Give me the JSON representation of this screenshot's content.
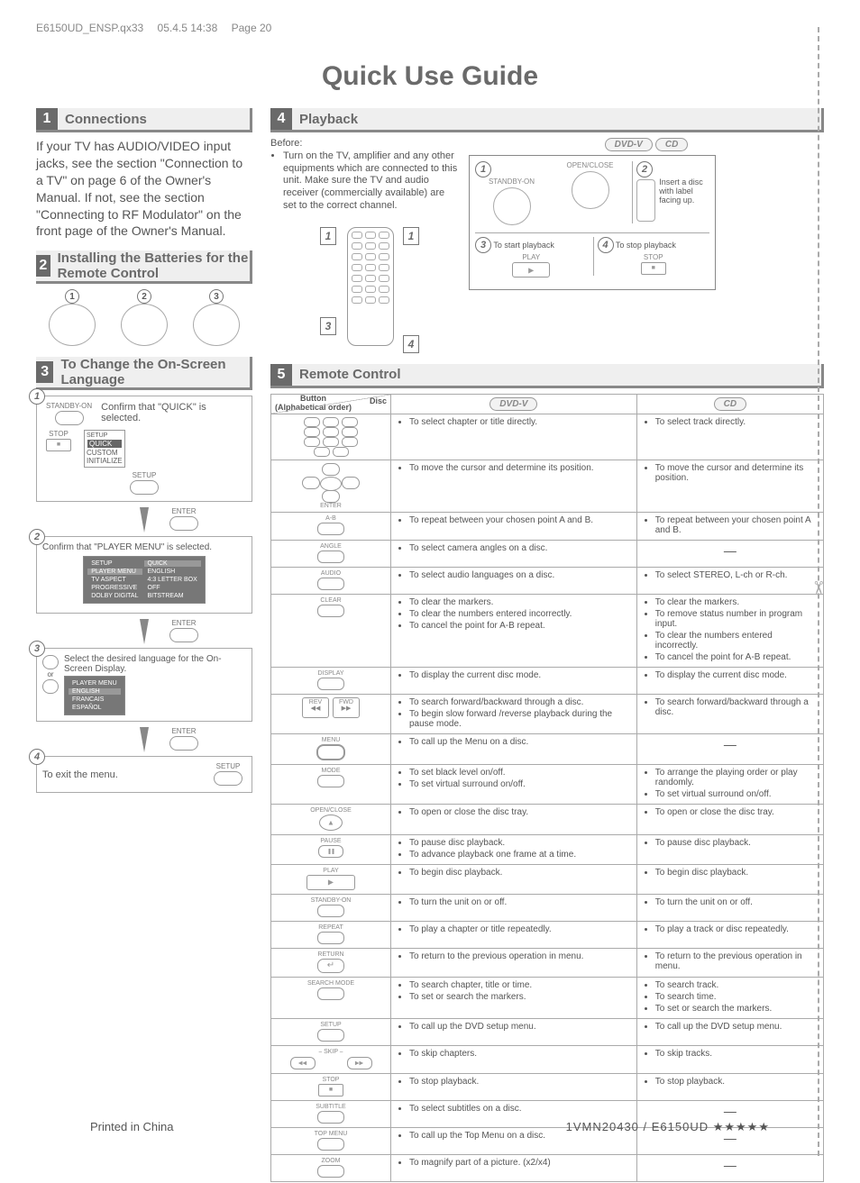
{
  "meta": {
    "file": "E6150UD_ENSP.qx33",
    "date": "05.4.5 14:38",
    "page": "Page 20"
  },
  "title": "Quick Use Guide",
  "sections": {
    "s1": {
      "num": "1",
      "title": "Connections"
    },
    "s2": {
      "num": "2",
      "title": "Installing the Batteries for the Remote Control"
    },
    "s3": {
      "num": "3",
      "title": "To Change the On-Screen Language"
    },
    "s4": {
      "num": "4",
      "title": "Playback"
    },
    "s5": {
      "num": "5",
      "title": "Remote Control"
    }
  },
  "connections_para": "If your TV has AUDIO/VIDEO input jacks, see the section \"Connection to a TV\" on page 6 of the Owner's Manual. If not, see the section \"Connecting to RF Modulator\" on the front page of the Owner's Manual.",
  "battery_steps": [
    "1",
    "2",
    "3"
  ],
  "lang": {
    "step1": {
      "num": "1",
      "standby": "STANDBY-ON",
      "confirm": "Confirm that \"QUICK\" is selected.",
      "stop": "STOP",
      "setup": "SETUP",
      "q": "QUICK",
      "c": "CUSTOM",
      "i": "INITIALIZE",
      "setup2": "SETUP"
    },
    "step2": {
      "num": "2",
      "enter": "ENTER",
      "confirm": "Confirm that \"PLAYER MENU\" is selected.",
      "menu": {
        "h1": "SETUP",
        "h2": "QUICK",
        "r1a": "PLAYER MENU",
        "r1b": "ENGLISH",
        "r2a": "TV ASPECT",
        "r2b": "4:3 LETTER BOX",
        "r3a": "PROGRESSIVE",
        "r3b": "OFF",
        "r4a": "DOLBY DIGITAL",
        "r4b": "BITSTREAM"
      }
    },
    "step3": {
      "num": "3",
      "enter": "ENTER",
      "sel": "Select the desired language for the On-Screen Display.",
      "or": "or",
      "menu": {
        "h": "PLAYER MENU",
        "o1": "ENGLISH",
        "o2": "FRANCAIS",
        "o3": "ESPAÑOL"
      }
    },
    "step4": {
      "num": "4",
      "enter": "ENTER",
      "exit": "To exit the menu.",
      "setup": "SETUP"
    }
  },
  "playback": {
    "before": "Before:",
    "bullet": "Turn on the TV, amplifier and any other equipments which are connected to this unit. Make sure the TV and audio receiver (commercially available) are set to the correct channel.",
    "callouts": {
      "c1": "1",
      "c2": "1",
      "c3": "3",
      "c4": "4"
    },
    "badges": {
      "dvd": "DVD-V",
      "cd": "CD"
    },
    "standby": "STANDBY-ON",
    "openclose": "OPEN/CLOSE",
    "insert": "Insert a disc with label facing up.",
    "p1": "1",
    "p2": "2",
    "p3": "3",
    "p4": "4",
    "start": "To start playback",
    "stop": "To stop playback",
    "play": "PLAY",
    "stopl": "STOP"
  },
  "rc": {
    "head_disc": "Disc",
    "head_btn": "Button\n(Alphabetical order)",
    "rows": [
      {
        "label_type": "numbers",
        "label": "",
        "dvd": "To select chapter or title directly.",
        "cd": "To select track directly."
      },
      {
        "label_type": "arrows",
        "label": "ENTER",
        "dvd": "To move the cursor and determine its position.",
        "cd": "To move the cursor and determine its position."
      },
      {
        "label": "A-B",
        "dvd": "To repeat between your chosen point A and B.",
        "cd": "To repeat between your chosen point A and B."
      },
      {
        "label": "ANGLE",
        "dvd": "To select camera angles on a disc.",
        "cd": "—"
      },
      {
        "label": "AUDIO",
        "dvd": "To select audio languages on a disc.",
        "cd": "To select STEREO, L-ch or R-ch."
      },
      {
        "label": "CLEAR",
        "dvd_list": [
          "To clear the markers.",
          "To clear the numbers entered incorrectly.",
          "To cancel the point for A-B repeat."
        ],
        "cd_list": [
          "To clear the markers.",
          "To remove status number in program input.",
          "To clear the numbers entered incorrectly.",
          "To cancel the point for A-B repeat."
        ]
      },
      {
        "label": "DISPLAY",
        "dvd": "To display the current disc mode.",
        "cd": "To display the current disc mode."
      },
      {
        "label_type": "revfwd",
        "label": "",
        "rev": "REV",
        "fwd": "FWD",
        "dvd_list": [
          "To search forward/backward through a disc.",
          "To begin slow forward /reverse playback during the pause mode."
        ],
        "cd": "To search forward/backward through a disc."
      },
      {
        "label": "MENU",
        "draw": "thick",
        "dvd": "To call up the Menu on a disc.",
        "cd": "—"
      },
      {
        "label": "MODE",
        "dvd_list": [
          "To set black level on/off.",
          "To set virtual surround on/off."
        ],
        "cd_list": [
          "To arrange the playing order or play randomly.",
          "To set virtual surround on/off."
        ]
      },
      {
        "label": "OPEN/CLOSE",
        "draw": "eject",
        "dvd": "To open or close the disc tray.",
        "cd": "To open or close the disc tray."
      },
      {
        "label": "PAUSE",
        "draw": "pause",
        "dvd_list": [
          "To pause disc playback.",
          "To advance playback one frame at a time."
        ],
        "cd": "To pause disc playback."
      },
      {
        "label": "PLAY",
        "draw": "play",
        "dvd": "To begin disc playback.",
        "cd": "To begin disc playback."
      },
      {
        "label": "STANDBY-ON",
        "dvd": "To turn the unit on or off.",
        "cd": "To turn the unit on or off."
      },
      {
        "label": "REPEAT",
        "dvd": "To play a chapter or title repeatedly.",
        "cd": "To play a track or disc repeatedly."
      },
      {
        "label": "RETURN",
        "draw": "return",
        "dvd": "To return to the previous operation in menu.",
        "cd": "To return to the previous operation in menu."
      },
      {
        "label": "SEARCH MODE",
        "dvd_list": [
          "To search chapter, title or time.",
          "To set or search the markers."
        ],
        "cd_list": [
          "To search track.",
          "To search time.",
          "To set or search the markers."
        ]
      },
      {
        "label": "SETUP",
        "dvd": "To call up the DVD setup menu.",
        "cd": "To call up the DVD setup menu."
      },
      {
        "label_type": "skip",
        "label": "SKIP",
        "dvd": "To skip chapters.",
        "cd": "To skip tracks."
      },
      {
        "label": "STOP",
        "draw": "stop",
        "dvd": "To stop playback.",
        "cd": "To stop playback."
      },
      {
        "label": "SUBTITLE",
        "dvd": "To select subtitles on a disc.",
        "cd": "—"
      },
      {
        "label": "TOP MENU",
        "dvd": "To call up the Top Menu on a disc.",
        "cd": "—"
      },
      {
        "label": "ZOOM",
        "dvd": "To magnify part of a picture. (x2/x4)",
        "cd": "—"
      }
    ]
  },
  "footer": {
    "left": "Printed in China",
    "right": "1VMN20430 / E6150UD ★★★★★"
  }
}
